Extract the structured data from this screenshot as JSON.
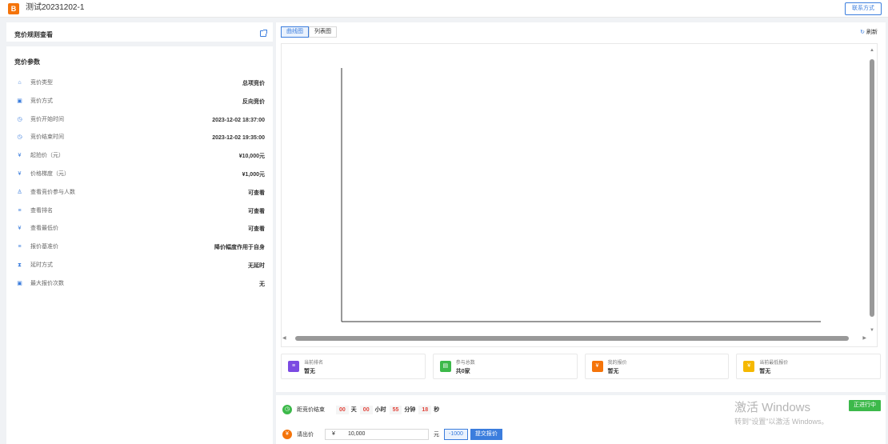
{
  "header": {
    "logo_glyph": "B",
    "title": "测试20231202-1",
    "contact_button": "联系方式"
  },
  "rules": {
    "title": "竞价规则查看",
    "link_icon": "external-link-icon"
  },
  "params": {
    "title": "竞价参数",
    "items": [
      {
        "icon": "home-icon",
        "glyph": "⌂",
        "label": "竞价类型",
        "value": "总项竞价"
      },
      {
        "icon": "card-icon",
        "glyph": "▣",
        "label": "竞价方式",
        "value": "反向竞价"
      },
      {
        "icon": "clock-icon",
        "glyph": "◷",
        "label": "竞价开始时间",
        "value": "2023-12-02 18:37:00"
      },
      {
        "icon": "clock-icon",
        "glyph": "◷",
        "label": "竞价结束时间",
        "value": "2023-12-02 19:35:00"
      },
      {
        "icon": "yen-icon",
        "glyph": "¥",
        "label": "起拍价（元）",
        "value": "¥10,000元"
      },
      {
        "icon": "yen-icon",
        "glyph": "¥",
        "label": "价格梯度（元）",
        "value": "¥1,000元"
      },
      {
        "icon": "person-icon",
        "glyph": "♙",
        "label": "查看竞价参与人数",
        "value": "可查看"
      },
      {
        "icon": "list-icon",
        "glyph": "≡",
        "label": "查看排名",
        "value": "可查看"
      },
      {
        "icon": "yen-icon",
        "glyph": "¥",
        "label": "查看最低价",
        "value": "可查看"
      },
      {
        "icon": "list-icon",
        "glyph": "≡",
        "label": "报价基准价",
        "value": "降价幅度作用于自身"
      },
      {
        "icon": "hourglass-icon",
        "glyph": "⧗",
        "label": "延时方式",
        "value": "无延时"
      },
      {
        "icon": "card-icon",
        "glyph": "▣",
        "label": "最大报价次数",
        "value": "无"
      }
    ]
  },
  "chart": {
    "tabs": [
      {
        "label": "曲线图",
        "active": true
      },
      {
        "label": "列表图",
        "active": false
      }
    ],
    "refresh_label": "刷新"
  },
  "chart_data": {
    "type": "line",
    "title": "",
    "xlabel": "",
    "ylabel": "",
    "series": [],
    "grid": false
  },
  "stats": [
    {
      "icon": "rank-icon",
      "color": "#7b4ae2",
      "label": "当前排名",
      "value": "暂无"
    },
    {
      "icon": "participants-icon",
      "color": "#3cb94a",
      "label": "参与总数",
      "value": "共0家"
    },
    {
      "icon": "my-bid-icon",
      "color": "#f5740a",
      "label": "我的报价",
      "value": "暂无"
    },
    {
      "icon": "lowest-bid-icon",
      "color": "#f5b800",
      "label": "当前最低报价",
      "value": "暂无"
    }
  ],
  "countdown": {
    "label": "距竞价结束",
    "days": "00",
    "days_unit": "天",
    "hours": "00",
    "hours_unit": "小时",
    "minutes": "55",
    "minutes_unit": "分钟",
    "seconds": "18",
    "seconds_unit": "秒"
  },
  "bid": {
    "label": "请出价",
    "currency": "¥",
    "value": "10,000",
    "unit": "元",
    "decrement": "-1000",
    "submit": "提交报价"
  },
  "status_badge": "正进行中",
  "watermark": {
    "line1": "激活 Windows",
    "line2": "转到\"设置\"以激活 Windows。"
  }
}
